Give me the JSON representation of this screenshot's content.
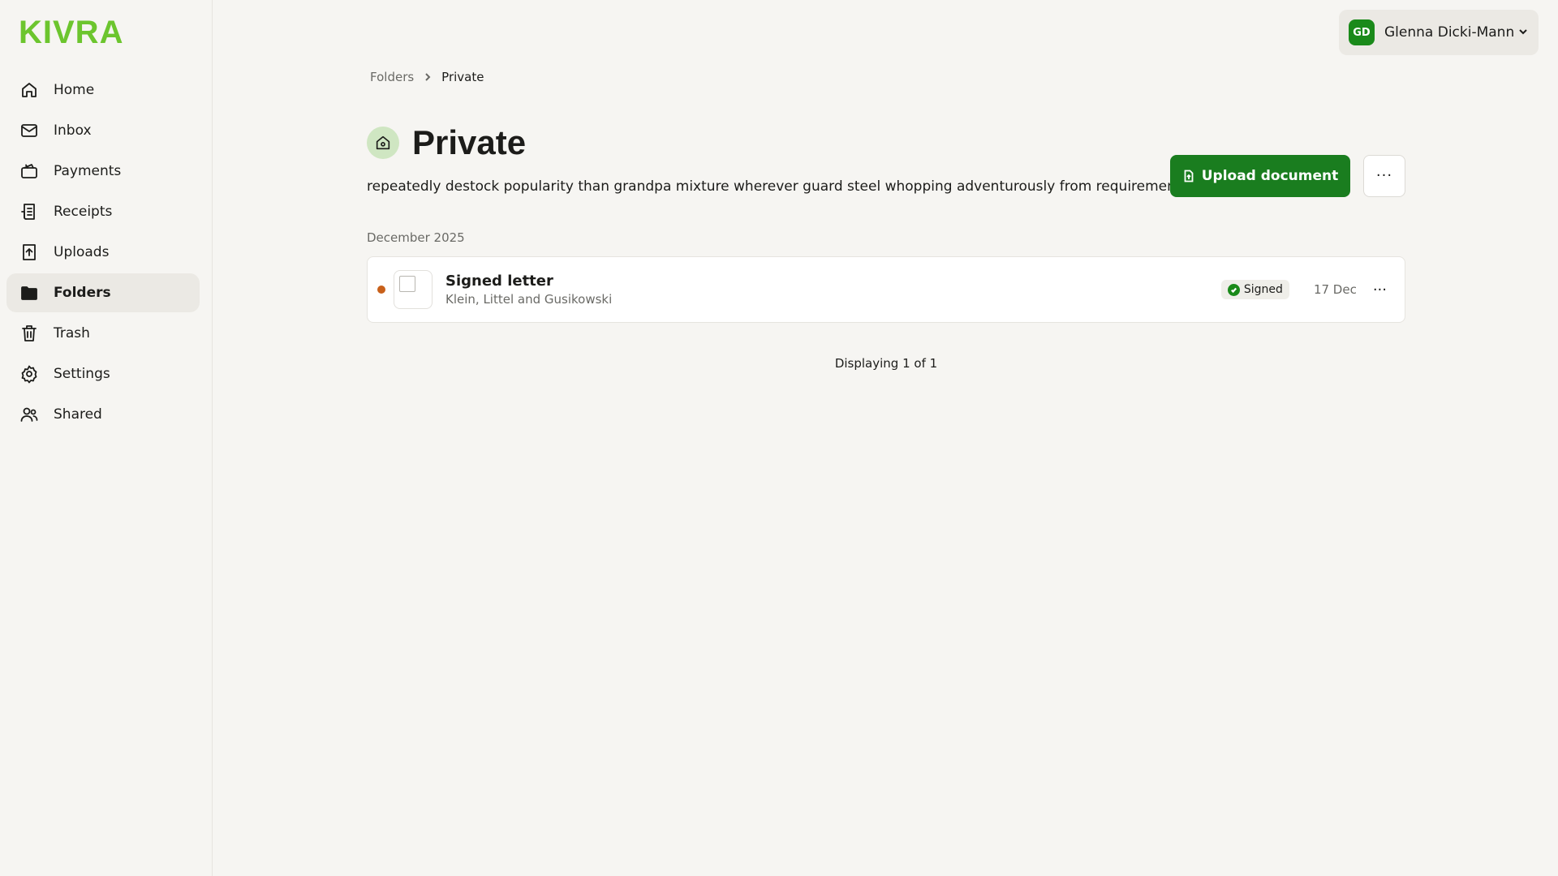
{
  "brand": {
    "logo": "KIVRA",
    "logo_color": "#6cc52e"
  },
  "sidebar": {
    "items": [
      {
        "label": "Home",
        "icon": "home-icon",
        "active": false
      },
      {
        "label": "Inbox",
        "icon": "mail-icon",
        "active": false
      },
      {
        "label": "Payments",
        "icon": "wallet-icon",
        "active": false
      },
      {
        "label": "Receipts",
        "icon": "receipt-icon",
        "active": false
      },
      {
        "label": "Uploads",
        "icon": "upload-icon",
        "active": false
      },
      {
        "label": "Folders",
        "icon": "folder-icon",
        "active": true
      },
      {
        "label": "Trash",
        "icon": "trash-icon",
        "active": false
      },
      {
        "label": "Settings",
        "icon": "gear-icon",
        "active": false
      },
      {
        "label": "Shared",
        "icon": "users-icon",
        "active": false
      }
    ]
  },
  "user": {
    "initials": "GD",
    "name": "Glenna Dicki-Mann",
    "avatar_color": "#1a8a1a"
  },
  "breadcrumb": {
    "parent": "Folders",
    "current": "Private"
  },
  "page": {
    "title": "Private",
    "description": "repeatedly destock popularity than grandpa mixture wherever guard steel whopping adventurously from requirement",
    "upload_label": "Upload document",
    "accent_color": "#1a7d1f"
  },
  "documents": {
    "group_label": "December 2025",
    "items": [
      {
        "title": "Signed letter",
        "sender": "Klein, Littel and Gusikowski",
        "status": "Signed",
        "date": "17 Dec",
        "unread_color": "#c8601a"
      }
    ]
  },
  "pagination": {
    "text": "Displaying 1 of 1"
  }
}
